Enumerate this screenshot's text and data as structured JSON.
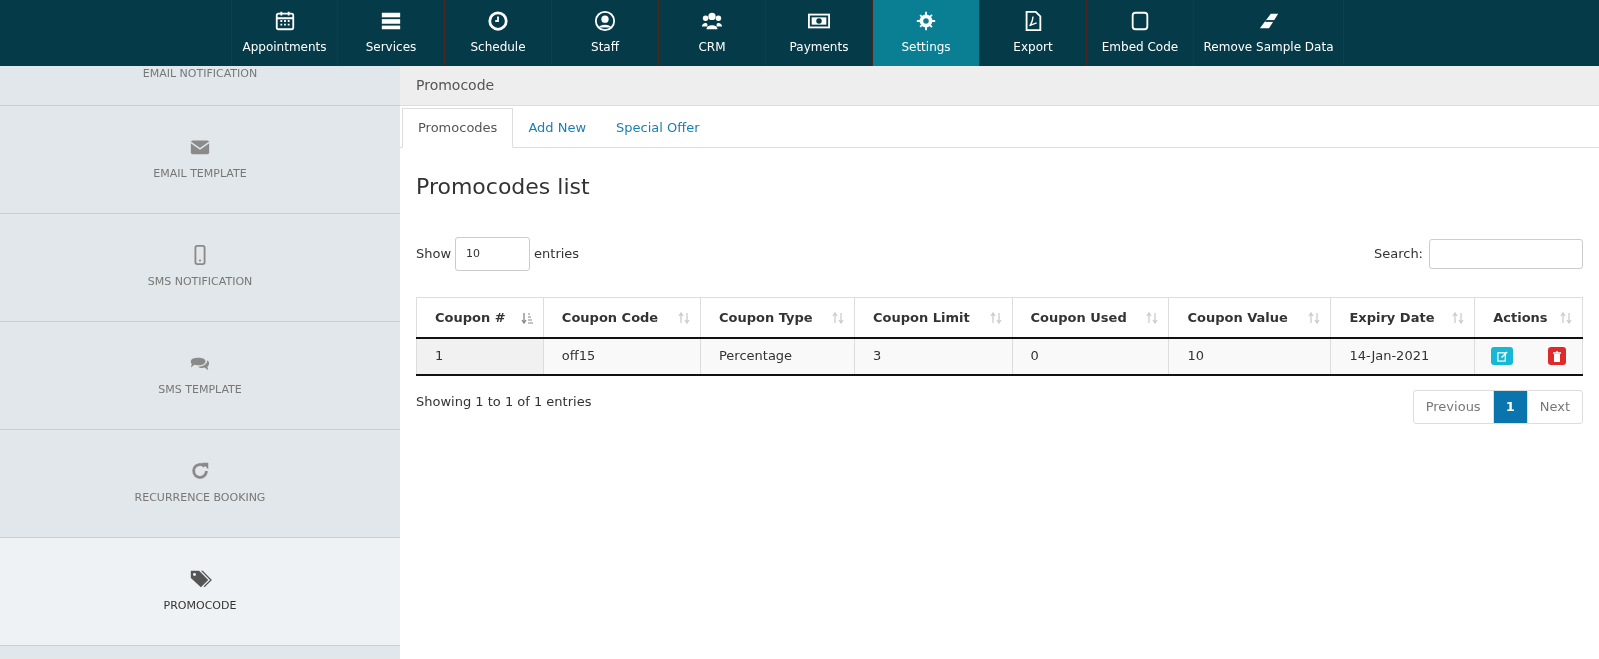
{
  "nav": [
    {
      "label": "Appointments",
      "selected": false
    },
    {
      "label": "Services",
      "selected": false
    },
    {
      "label": "Schedule",
      "selected": false
    },
    {
      "label": "Staff",
      "selected": false
    },
    {
      "label": "CRM",
      "selected": false
    },
    {
      "label": "Payments",
      "selected": false
    },
    {
      "label": "Settings",
      "selected": true
    },
    {
      "label": "Export",
      "selected": false
    },
    {
      "label": "Embed Code",
      "selected": false
    },
    {
      "label": "Remove Sample Data",
      "selected": false
    }
  ],
  "sidebar": {
    "items": [
      {
        "label": "EMAIL NOTIFICATION",
        "selected": false
      },
      {
        "label": "EMAIL TEMPLATE",
        "selected": false
      },
      {
        "label": "SMS NOTIFICATION",
        "selected": false
      },
      {
        "label": "SMS TEMPLATE",
        "selected": false
      },
      {
        "label": "RECURRENCE BOOKING",
        "selected": false
      },
      {
        "label": "PROMOCODE",
        "selected": true
      }
    ]
  },
  "panel_title": "Promocode",
  "tabs": [
    {
      "label": "Promocodes",
      "selected": true
    },
    {
      "label": "Add New",
      "selected": false
    },
    {
      "label": "Special Offer",
      "selected": false
    }
  ],
  "heading": "Promocodes list",
  "length": {
    "before": "Show",
    "value": "10",
    "after": "entries"
  },
  "search": {
    "label": "Search:"
  },
  "table": {
    "columns": [
      {
        "label": "Coupon #",
        "sorted": true
      },
      {
        "label": "Coupon Code",
        "sorted": false
      },
      {
        "label": "Coupon Type",
        "sorted": false
      },
      {
        "label": "Coupon Limit",
        "sorted": false
      },
      {
        "label": "Coupon Used",
        "sorted": false
      },
      {
        "label": "Coupon Value",
        "sorted": false
      },
      {
        "label": "Expiry Date",
        "sorted": false
      },
      {
        "label": "Actions",
        "sorted": false
      }
    ],
    "rows": [
      {
        "cells": [
          "1",
          "off15",
          "Percentage",
          "3",
          "0",
          "10",
          "14-Jan-2021"
        ]
      }
    ]
  },
  "info": "Showing 1 to 1 of 1 entries",
  "pagination": [
    {
      "label": "Previous",
      "selected": false
    },
    {
      "label": "1",
      "selected": true
    },
    {
      "label": "Next",
      "selected": false
    }
  ]
}
